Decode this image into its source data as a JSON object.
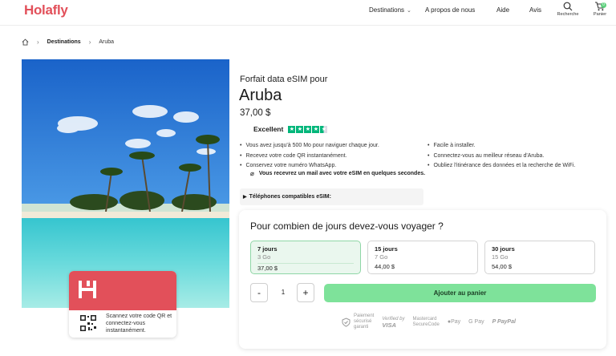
{
  "header": {
    "logo": "Holafly",
    "nav": [
      {
        "label": "Destinations",
        "has_dropdown": true
      },
      {
        "label": "A propos de nous"
      },
      {
        "label": "Aide"
      },
      {
        "label": "Avis"
      }
    ],
    "search_label": "Recherche",
    "cart_label": "Panier",
    "cart_count": "0"
  },
  "breadcrumb": {
    "home_icon": "home-icon",
    "items": [
      "Destinations",
      "Aruba"
    ]
  },
  "card": {
    "scan_text": "Scannez votre code QR et connectez-vous instantanément."
  },
  "product": {
    "subtitle": "Forfait data eSIM pour",
    "title": "Aruba",
    "price": "37,00 $",
    "rating_label": "Excellent",
    "rating_stars": 4.5,
    "features_left": [
      "Vous avez jusqu'à 500 Mo pour naviguer chaque jour.",
      "Recevez votre code QR instantanément.",
      "Conservez votre numéro WhatsApp."
    ],
    "features_right": [
      "Facile à installer.",
      "Connectez-vous au meilleur réseau d'Aruba.",
      "Oubliez l'itinérance des données et la recherche de WiFi."
    ],
    "mail_note": "Vous recevrez un mail avec votre eSIM en quelques secondes.",
    "compat_label": "Téléphones compatibles eSIM:"
  },
  "days_panel": {
    "question": "Pour combien de jours devez-vous voyager ?",
    "plans": [
      {
        "days": "7 jours",
        "data": "3 Go",
        "price": "37,00 $",
        "selected": true
      },
      {
        "days": "15 jours",
        "data": "7 Go",
        "price": "44,00 $",
        "selected": false
      },
      {
        "days": "30 jours",
        "data": "15 Go",
        "price": "54,00 $",
        "selected": false
      }
    ],
    "quantity": "1",
    "minus_label": "-",
    "plus_label": "+",
    "add_to_cart": "Ajouter au panier",
    "payments": {
      "secure_line1": "Paiement",
      "secure_line2": "sécurisé",
      "secure_line3": "garanti",
      "visa_line1": "Verified by",
      "visa_line2": "VISA",
      "mc_line1": "Mastercard",
      "mc_line2": "SecureCode",
      "apple_pay": "Pay",
      "google_pay": "G Pay",
      "paypal": "PayPal"
    }
  },
  "colors": {
    "brand": "#e2505a",
    "accent_green": "#7ee29a",
    "trustpilot_green": "#00b67a"
  }
}
